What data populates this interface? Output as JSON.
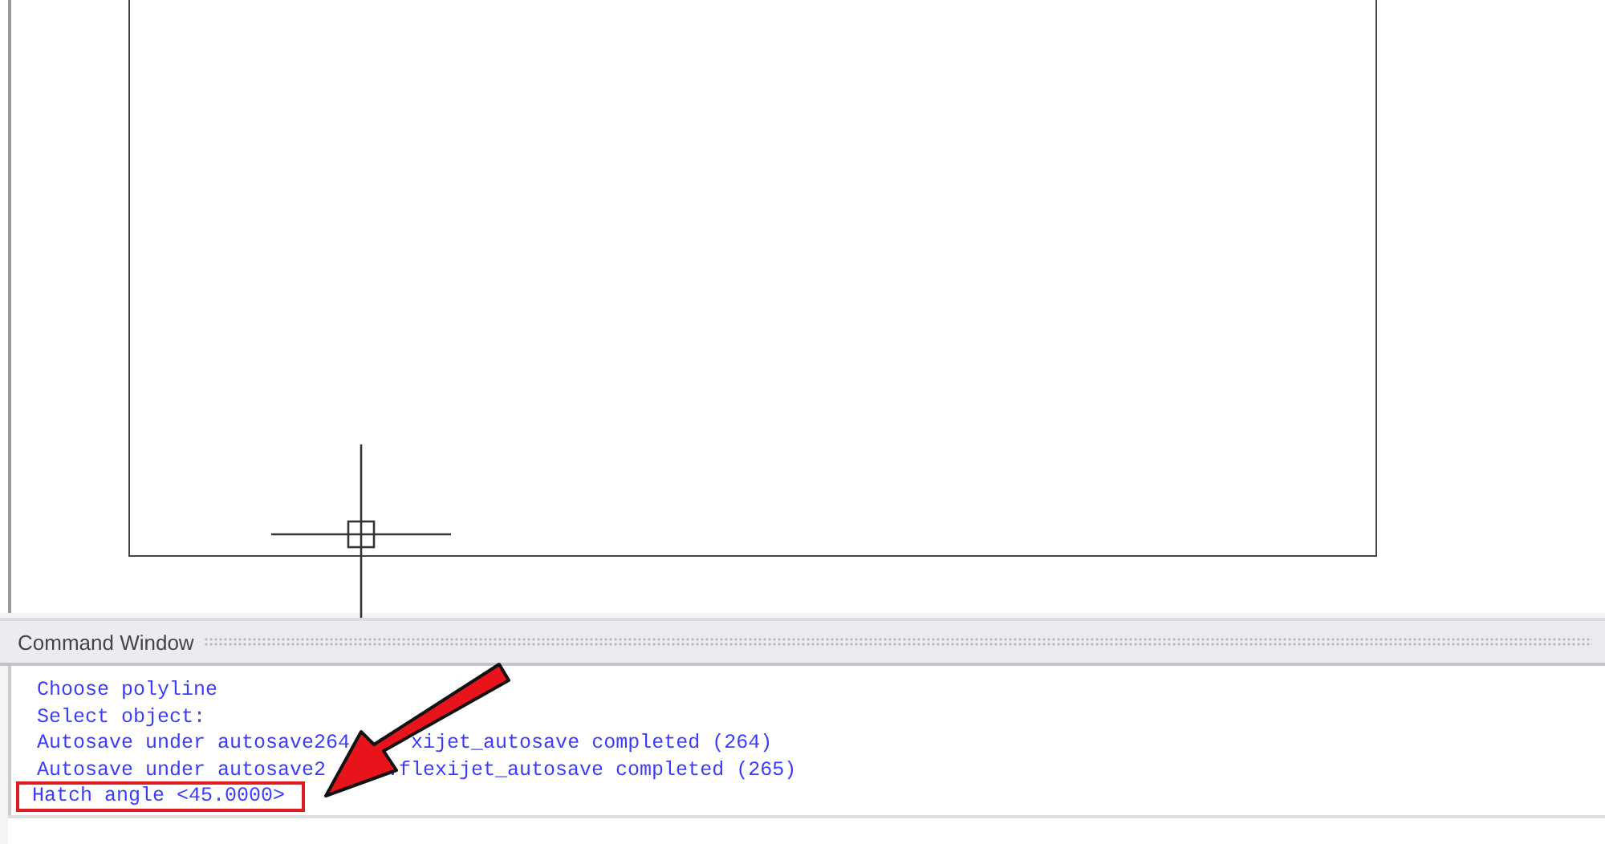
{
  "command_window": {
    "title": "Command Window",
    "lines": [
      {
        "parts": [
          "Choose polyline"
        ],
        "highlighted": false
      },
      {
        "parts": [
          "Select object:"
        ],
        "highlighted": false
      },
      {
        "parts": [
          "Autosave under autosave264",
          "xijet_autosave completed (264)"
        ],
        "highlighted": false
      },
      {
        "parts": [
          "Autosave under autosave2",
          ".flexijet_autosave completed (265)"
        ],
        "highlighted": false
      },
      {
        "parts": [
          "Hatch angle <45.0000>"
        ],
        "highlighted": true
      }
    ]
  }
}
